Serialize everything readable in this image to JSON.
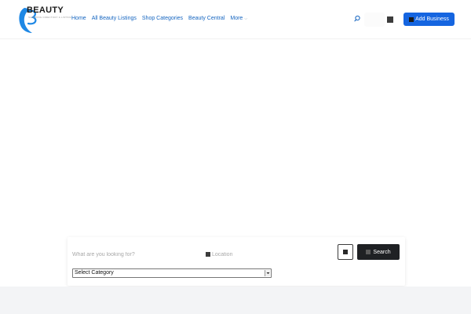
{
  "header": {
    "logo": {
      "word": "BEAUTY",
      "tagline": "SHOPPING DIRECTORY & LISTING",
      "accent_color": "#1e88e5"
    },
    "nav": [
      {
        "label": "Home"
      },
      {
        "label": "All Beauty Listings"
      },
      {
        "label": "Shop Categories"
      },
      {
        "label": "Beauty Central"
      },
      {
        "label": "More"
      }
    ],
    "icons": {
      "search": "search-icon",
      "account": "square-icon",
      "dropdown": "chevron-down-icon"
    },
    "add_business_label": "Add Business",
    "colors": {
      "nav_link": "#1565c0",
      "primary_button": "#1565e0"
    }
  },
  "search": {
    "keyword_placeholder": "What are you looking for?",
    "location_placeholder": "Location",
    "search_button_label": "Search",
    "category_selected": "Select Category",
    "colors": {
      "search_button": "#1f2124"
    }
  }
}
